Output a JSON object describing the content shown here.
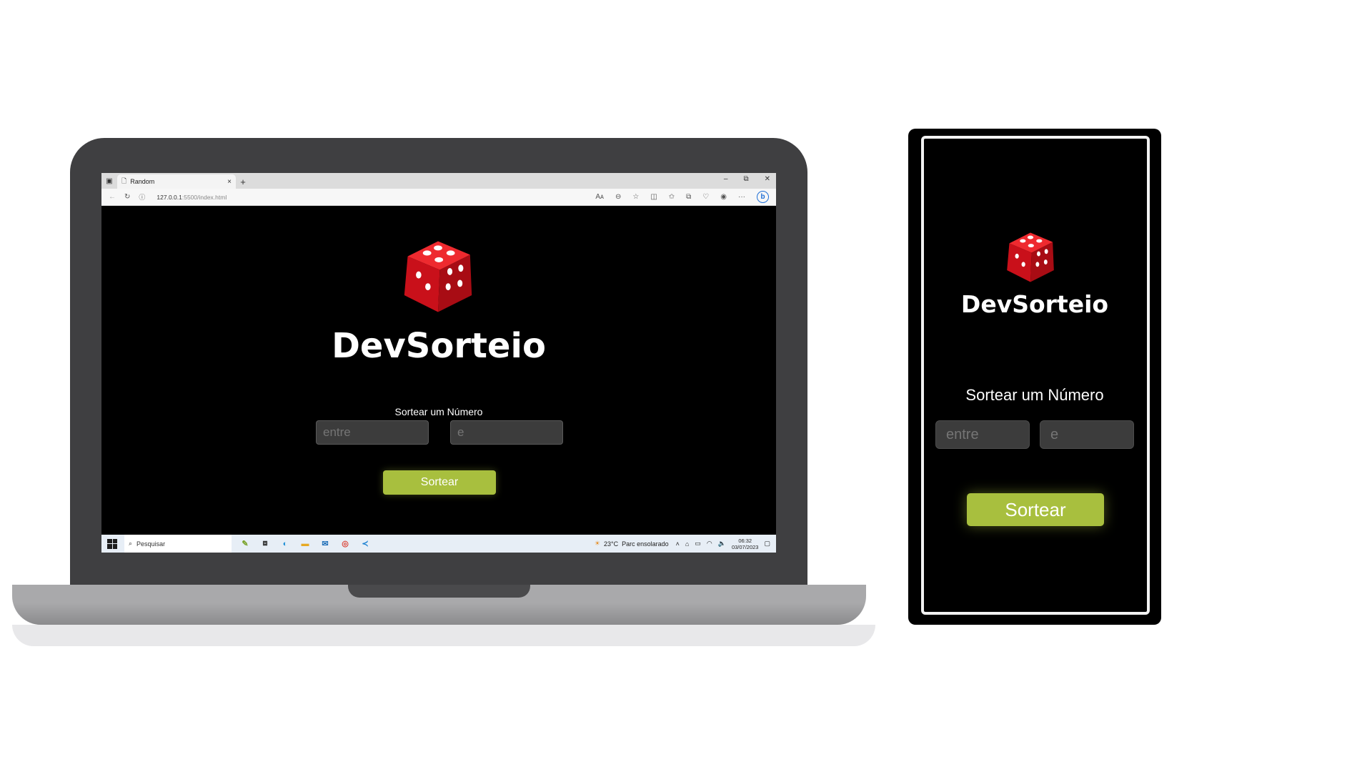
{
  "browser": {
    "tab_title": "Random",
    "tab_close": "×",
    "new_tab": "+",
    "minimize": "–",
    "restore": "⧉",
    "close": "✕",
    "url_host": "127.0.0.1",
    "url_path": ":5500/index.html",
    "read_aloud": "Aᴀ",
    "more": "···"
  },
  "app": {
    "brand": "DevSorteio",
    "subtitle": "Sortear um Número",
    "input_min_placeholder": "entre",
    "input_max_placeholder": "e",
    "button_label": "Sortear"
  },
  "taskbar": {
    "search_label": "Pesquisar",
    "weather_temp": "23°C",
    "weather_desc": "Parc ensolarado",
    "time": "06:32",
    "date": "03/07/2023"
  },
  "colors": {
    "accent": "#a8bf3e",
    "dice_red": "#d8141a",
    "laptop_body": "#3f3f41",
    "page_bg": "#000000",
    "input_bg": "#3c3c3c"
  }
}
